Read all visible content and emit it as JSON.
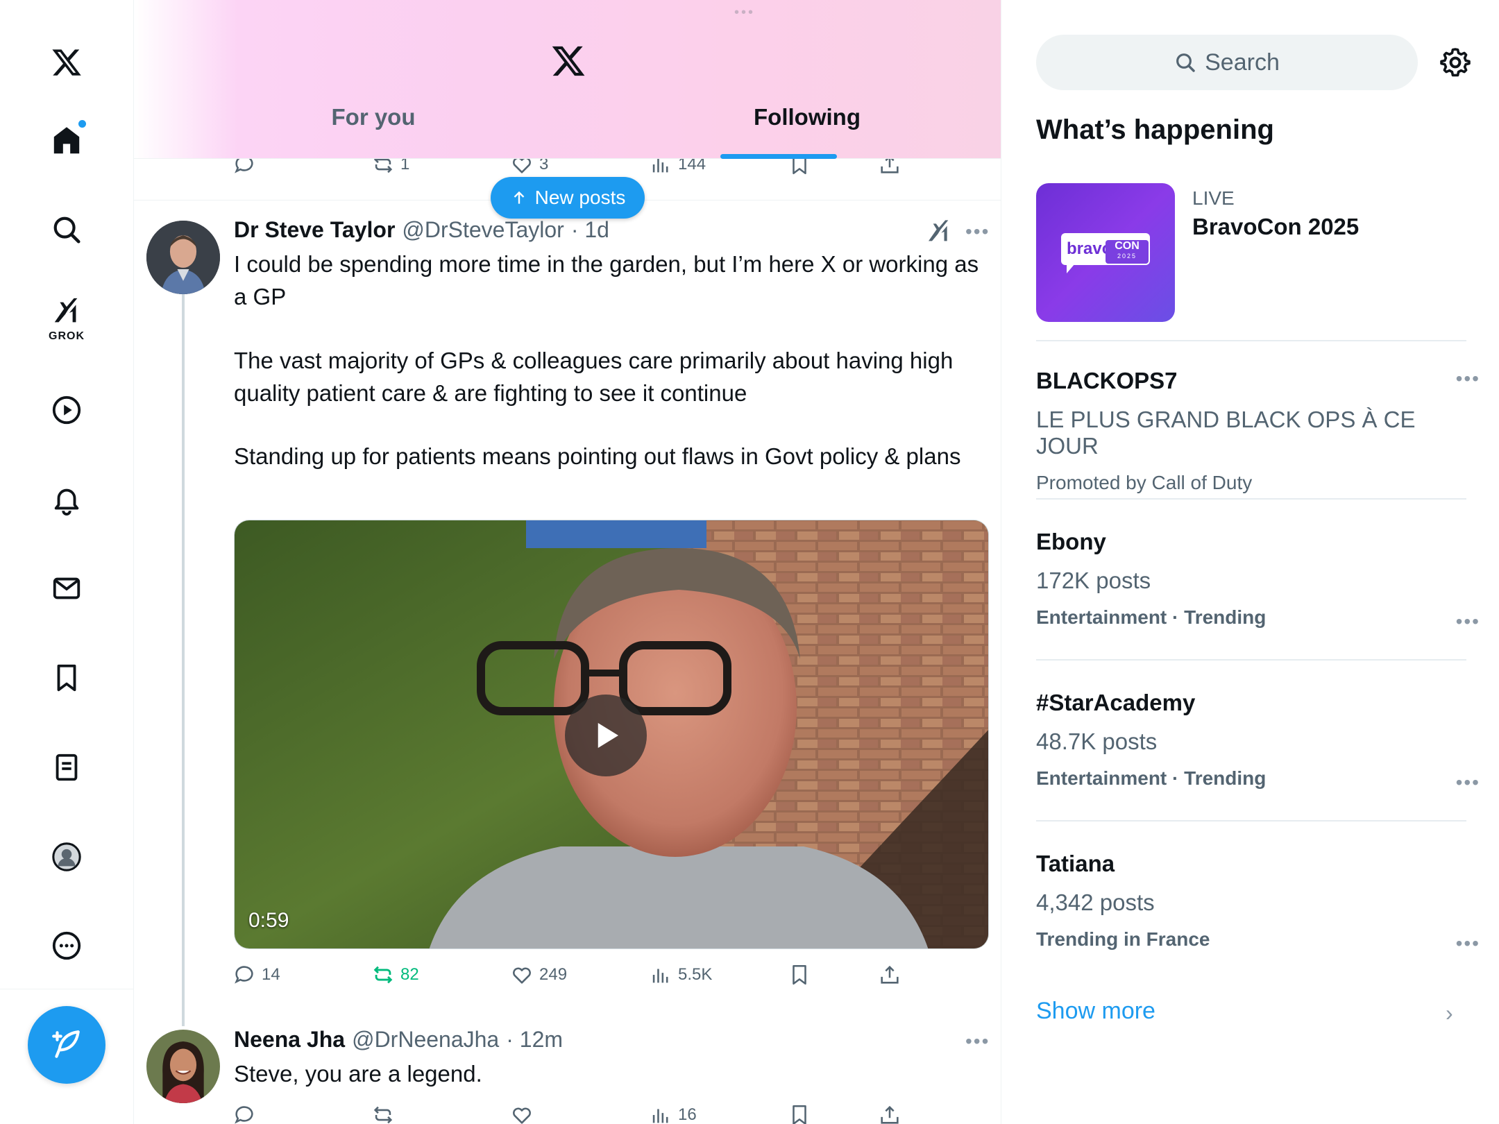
{
  "header": {
    "tabs": [
      {
        "label": "For you",
        "active": false
      },
      {
        "label": "Following",
        "active": true
      }
    ]
  },
  "new_posts_label": "New posts",
  "prev_post_actions": {
    "replies": "",
    "reposts": "1",
    "likes": "3",
    "views": "144"
  },
  "post": {
    "name": "Dr Steve Taylor",
    "handle": "@DrSteveTaylor",
    "time": "· 1d",
    "text1": "I could be spending more time in the garden, but I’m here X or working as a GP",
    "text2": "The vast majority of GPs & colleagues care primarily about having high quality patient care & are fighting to see it continue",
    "text3": "Standing up for patients means pointing out flaws in Govt policy & plans",
    "video_duration": "0:59",
    "actions": {
      "replies": "14",
      "reposts": "82",
      "likes": "249",
      "views": "5.5K"
    }
  },
  "reply": {
    "name": "Neena Jha",
    "handle": "@DrNeenaJha",
    "time": "· 12m",
    "text": "Steve, you are a legend.",
    "actions": {
      "views": "16"
    }
  },
  "nav": {
    "grok_label": "GROK",
    "icons": [
      "x-logo-icon",
      "home-icon",
      "search-icon",
      "grok-icon",
      "video-icon",
      "bell-icon",
      "mail-icon",
      "bookmark-icon",
      "list-icon",
      "profile-icon",
      "more-icon"
    ]
  },
  "sidebar": {
    "search_placeholder": "Search",
    "title": "What’s happening",
    "live": {
      "label": "LIVE",
      "title": "BravoCon 2025",
      "thumb_text": "bravo",
      "thumb_text2": "CON",
      "thumb_year": "2025"
    },
    "trends": [
      {
        "name": "BLACKOPS7",
        "sub": "LE PLUS GRAND BLACK OPS À CE JOUR",
        "meta": "Promoted by Call of Duty"
      },
      {
        "name": "Ebony",
        "sub": "172K posts",
        "meta": "Entertainment · Trending"
      },
      {
        "name": "#StarAcademy",
        "sub": "48.7K posts",
        "meta": "Entertainment · Trending"
      },
      {
        "name": "Tatiana",
        "sub": "4,342 posts",
        "meta": "Trending in France"
      }
    ],
    "show_more": "Show more"
  },
  "colors": {
    "accent": "#1d9bf0",
    "repost_active": "#00ba7c",
    "secondary_text": "#536471"
  }
}
